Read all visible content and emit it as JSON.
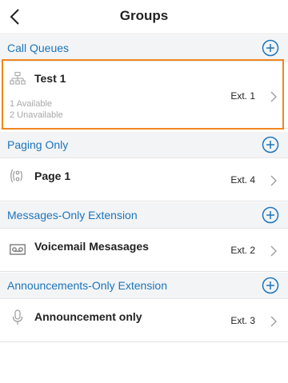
{
  "header": {
    "title": "Groups"
  },
  "colors": {
    "accent": "#1b75bb",
    "selection": "#f0861f",
    "section_bg": "#f3f4f6"
  },
  "sections": [
    {
      "title": "Call Queues",
      "items": [
        {
          "name": "Test 1",
          "ext": "Ext. 1",
          "available": "1 Available",
          "unavailable": "2 Unavailable",
          "icon": "org-chart-icon"
        }
      ]
    },
    {
      "title": "Paging Only",
      "items": [
        {
          "name": "Page 1",
          "ext": "Ext. 4",
          "icon": "broadcast-icon"
        }
      ]
    },
    {
      "title": "Messages-Only Extension",
      "items": [
        {
          "name": "Voicemail Mesasages",
          "ext": "Ext. 2",
          "icon": "voicemail-icon"
        }
      ]
    },
    {
      "title": "Announcements-Only Extension",
      "items": [
        {
          "name": "Announcement only",
          "ext": "Ext. 3",
          "icon": "microphone-icon"
        }
      ]
    }
  ]
}
